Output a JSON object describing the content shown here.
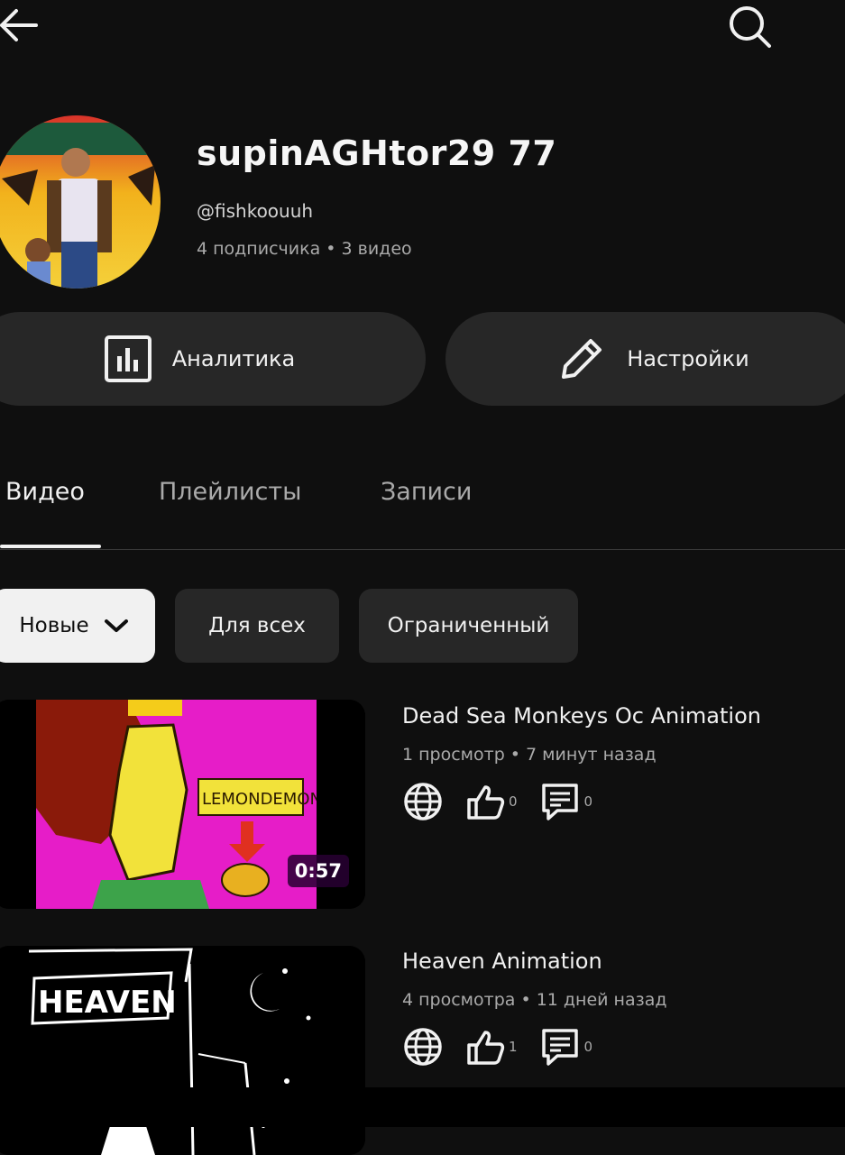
{
  "header": {
    "back_icon": "arrow-left-icon",
    "search_icon": "search-icon"
  },
  "channel": {
    "name": "supinAGHtor29 77",
    "handle": "@fishkoouuh",
    "stats": "4 подписчика • 3 видео"
  },
  "actions": {
    "analytics_label": "Аналитика",
    "analytics_icon": "bar-chart-icon",
    "settings_label": "Настройки",
    "settings_icon": "pencil-icon"
  },
  "tabs": [
    {
      "label": "Видео",
      "active": true
    },
    {
      "label": "Плейлисты",
      "active": false
    },
    {
      "label": "Записи",
      "active": false
    }
  ],
  "filters": {
    "sort_label": "Новые",
    "chips": [
      "Для всех",
      "Ограниченный"
    ]
  },
  "videos": [
    {
      "title": "Dead Sea Monkeys Oc Animation",
      "meta": "1 просмотр • 7 минут назад",
      "duration": "0:57",
      "likes": "0",
      "comments": "0"
    },
    {
      "title": "Heaven Animation",
      "meta": "4 просмотра • 11 дней назад",
      "likes": "1",
      "comments": "0"
    }
  ],
  "colors": {
    "background": "#0f0f0f",
    "surface": "#272727",
    "thumb_pink": "#e61dc8"
  }
}
